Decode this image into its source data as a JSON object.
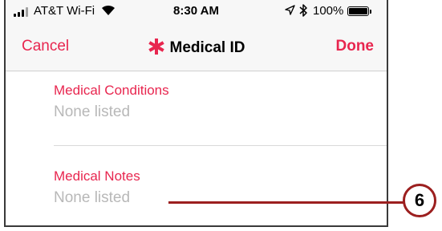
{
  "status_bar": {
    "carrier": "AT&T Wi-Fi",
    "time": "8:30 AM",
    "battery": "100%",
    "battery_level": 1.0,
    "icons": [
      "signal-bars-icon",
      "wifi-icon",
      "location-arrow-icon",
      "bluetooth-icon",
      "battery-icon"
    ]
  },
  "nav": {
    "cancel_label": "Cancel",
    "title": "Medical ID",
    "done_label": "Done",
    "title_icon": "asterisk-icon"
  },
  "fields": [
    {
      "label": "Medical Conditions",
      "value": "None listed"
    },
    {
      "label": "Medical Notes",
      "value": "None listed"
    }
  ],
  "callout": {
    "number": "6"
  },
  "colors": {
    "accent": "#e8264f",
    "placeholder_text": "#b8b8b8",
    "callout": "#9c1f1f",
    "bar_background": "#f7f7f7"
  }
}
